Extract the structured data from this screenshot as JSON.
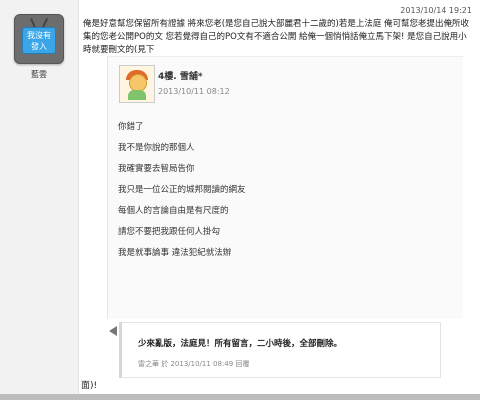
{
  "user": {
    "avatar_text_line1": "我沒有",
    "avatar_text_line2": "發入",
    "name": "藍雲"
  },
  "post": {
    "timestamp": "2013/10/14 19:21",
    "text": "俺是好意幫您保留所有證據 將來您老(是您自己說大部麗君十二歲的)若是上法庭 俺可幫您老提出俺所收集的您老公開PO的文 您若覺得自己的PO文有不適合公開 給俺一個悄悄話俺立馬下架! 是您自己說用小時就要刪文的(見下",
    "tail": "面)!"
  },
  "quote": {
    "author": "4樓. 雪舖*",
    "date": "2013/10/11 08:12",
    "lines": [
      "你錯了",
      "我不是你說的那個人",
      "我確實要去智局告你",
      "我只是一位公正的城邦閱讀的網友",
      "每個人的言論自由是有尺度的",
      "請您不要把我跟任何人掛勾",
      "我是就事論事 違法犯紀就法辦"
    ]
  },
  "reply": {
    "text": "少來亂版，法庭見！所有留言，二小時後，全部刪除。",
    "author": "雷之華",
    "meta_sep": "於",
    "date": "2013/10/11 08:49",
    "action": "回覆"
  }
}
